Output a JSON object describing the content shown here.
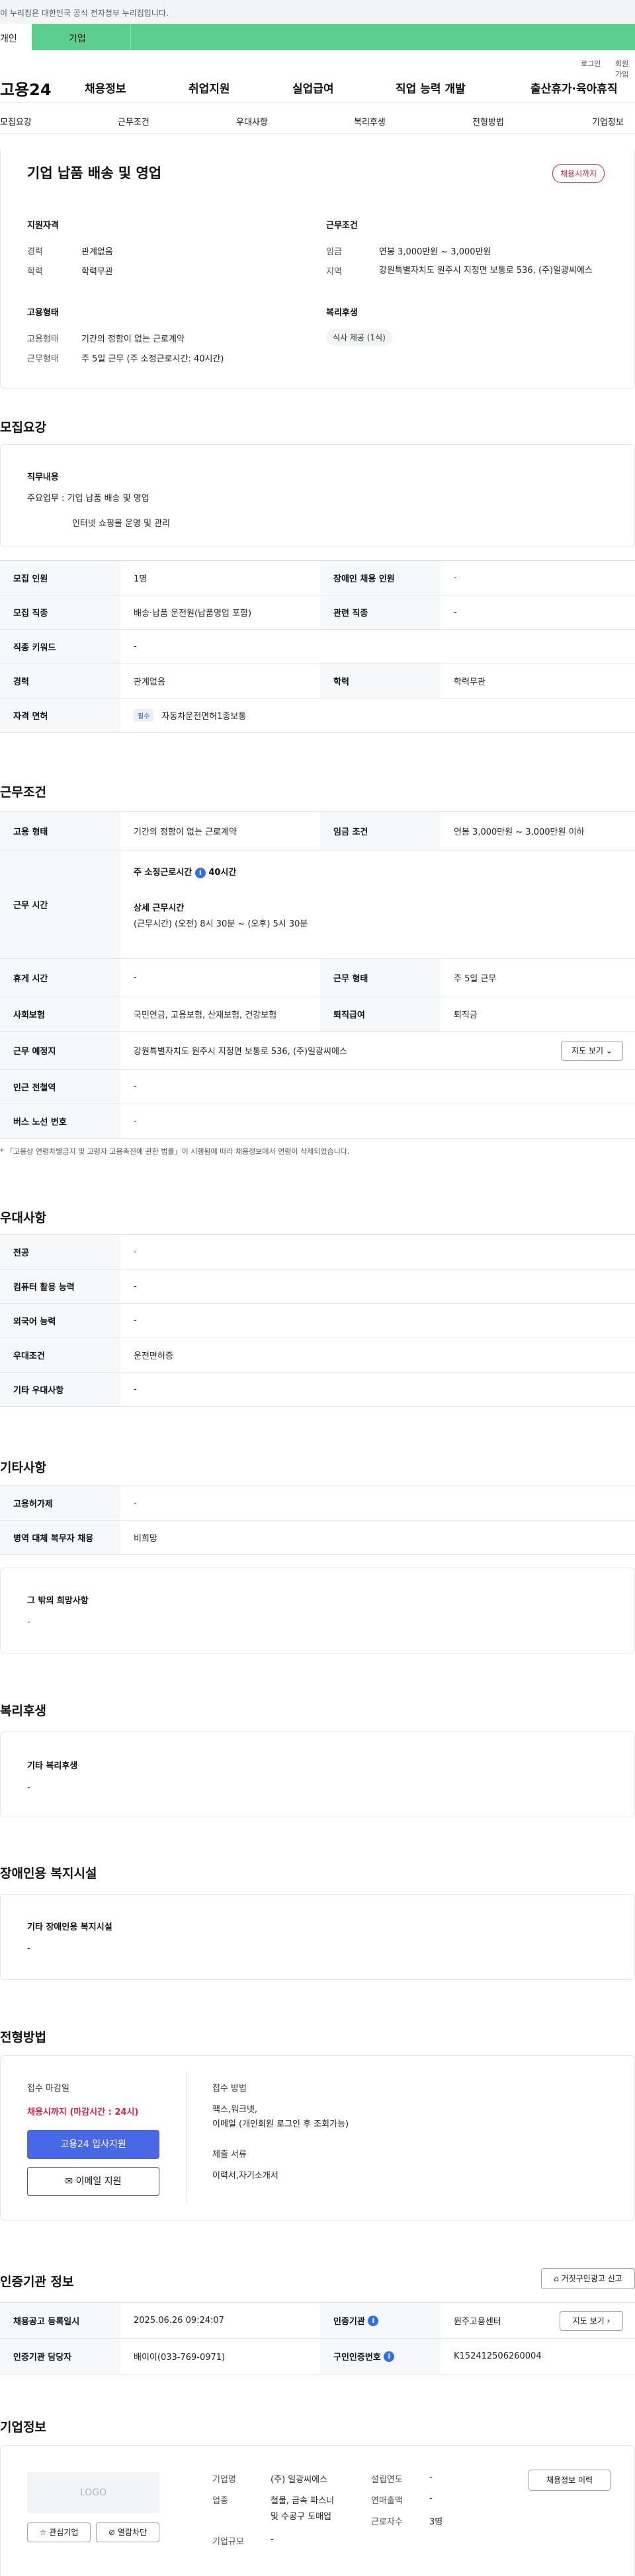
{
  "gov_banner": "이 누리집은 대한민국 공식 전자정부 누리집입니다.",
  "user_tabs": {
    "personal": "개인",
    "company": "기업"
  },
  "util": {
    "login": "로그인",
    "join": "회원가입"
  },
  "nav": {
    "logo": "고용24",
    "items": [
      "채용정보",
      "취업지원",
      "실업급여",
      "직업 능력 개발",
      "출산휴가·육아휴직"
    ]
  },
  "anchor": [
    "모집요강",
    "근무조건",
    "우대사항",
    "복리후생",
    "전형방법",
    "기업정보"
  ],
  "summary": {
    "title": "기업 납품 배송 및 영업",
    "badge": "채용시까지",
    "qual_title": "지원자격",
    "career_label": "경력",
    "career_value": "관계없음",
    "edu_label": "학력",
    "edu_value": "학력무관",
    "emp_title": "고용형태",
    "emp_label": "고용형태",
    "emp_value": "기간의 정함이 없는 근로계약",
    "work_label": "근무형태",
    "work_value": "주 5일 근무 (주 소정근로시간: 40시간)",
    "cond_title": "근무조건",
    "wage_label": "임금",
    "wage_value": "연봉 3,000만원 ~ 3,000만원",
    "area_label": "지역",
    "area_value": "강원특별자치도 원주시 지정면 보통로 536, (주)일광씨에스",
    "benefit_title": "복리후생",
    "benefit_chip": "식사 제공 (1식)"
  },
  "recruit": {
    "title": "모집요강",
    "duty_title": "직무내용",
    "duty_line1": "주요업무 : 기업 납품 배송 및 영업",
    "duty_line2": "인터넷 쇼핑몰 운영 및 관리",
    "rows": {
      "count_k": "모집 인원",
      "count_v": "1명",
      "disabled_k": "장애인 채용 인원",
      "disabled_v": "-",
      "job_k": "모집 직종",
      "job_v": "배송·납품 운전원(납품영업 포함)",
      "related_k": "관련 직종",
      "related_v": "-",
      "keyword_k": "직종 키워드",
      "keyword_v": "-",
      "career_k": "경력",
      "career_v": "관계없음",
      "edu_k": "학력",
      "edu_v": "학력무관",
      "license_k": "자격 면허",
      "license_tag": "필수",
      "license_v": "자동차운전면허1종보통"
    }
  },
  "work": {
    "title": "근무조건",
    "emp_k": "고용 형태",
    "emp_v": "기간의 정함이 없는 근로계약",
    "wage_k": "임금 조건",
    "wage_v": "연봉 3,000만원 ~ 3,000만원 이하",
    "time_k": "근무 시간",
    "time_weekly_label": "주 소정근로시간",
    "time_weekly_value": "40시간",
    "time_detail_label": "상세 근무시간",
    "time_detail_value": "(근무시간) (오전) 8시 30분 ~ (오후) 5시 30분",
    "rest_k": "휴게 시간",
    "rest_v": "-",
    "type_k": "근무 형태",
    "type_v": "주 5일 근무",
    "ins_k": "사회보험",
    "ins_v": "국민연금, 고용보험, 산재보험, 건강보험",
    "sev_k": "퇴직급여",
    "sev_v": "퇴직금",
    "place_k": "근무 예정지",
    "place_v": "강원특별자치도 원주시 지정면 보통로 536, (주)일광씨에스",
    "map_btn": "지도 보기",
    "subway_k": "인근 전철역",
    "subway_v": "-",
    "bus_k": "버스 노선 번호",
    "bus_v": "-",
    "note": "* 「고용상 연령차별금지 및 고령자 고용촉진에 관한 법률」이 시행됨에 따라 채용정보에서 연령이 삭제되었습니다."
  },
  "pref": {
    "title": "우대사항",
    "major_k": "전공",
    "major_v": "-",
    "pc_k": "컴퓨터 활용 능력",
    "pc_v": "-",
    "lang_k": "외국어 능력",
    "lang_v": "-",
    "cond_k": "우대조건",
    "cond_v": "운전면허증",
    "etc_k": "기타 우대사항",
    "etc_v": "-"
  },
  "etc": {
    "title": "기타사항",
    "permit_k": "고용허가제",
    "permit_v": "-",
    "military_k": "병역 대체 복무자 채용",
    "military_v": "비희망",
    "hope_title": "그 밖의 희망사항",
    "hope_v": "-"
  },
  "welfare": {
    "title": "복리후생",
    "box_title": "기타 복리후생",
    "box_v": "-"
  },
  "facility": {
    "title": "장애인용 복지시설",
    "box_title": "기타 장애인용 복지시설",
    "box_v": "-"
  },
  "selection": {
    "title": "전형방법",
    "deadline_label": "접수 마감일",
    "deadline_value": "채용시까지 (마감시간 : 24시)",
    "apply_btn": "고용24 입사지원",
    "email_btn": "이메일 지원",
    "method_label": "접수 방법",
    "method_value1": "팩스,워크넷,",
    "method_value2": "이메일 (개인회원 로그인 후 조회가능)",
    "docs_label": "제출 서류",
    "docs_value": "이력서,자기소개서"
  },
  "cert": {
    "title": "인증기관 정보",
    "report_btn": "거짓구인광고 신고",
    "reg_k": "채용공고 등록일시",
    "reg_v": "2025.06.26 09:24:07",
    "agency_k": "인증기관",
    "agency_v": "원주고용센터",
    "map_btn": "지도 보기",
    "manager_k": "인증기관 담당자",
    "manager_v": "배이이(033-769-0971)",
    "num_k": "구인인증번호",
    "num_v": "K152412506260004"
  },
  "company": {
    "title": "기업정보",
    "logo": "LOGO",
    "fav_btn": "관심기업",
    "block_btn": "열람차단",
    "name_k": "기업명",
    "name_v": "(주) 일광씨에스",
    "industry_k": "업종",
    "industry_v1": "철물, 금속 파스너",
    "industry_v2": "및 수공구 도매업",
    "size_k": "기업규모",
    "size_v": "-",
    "founded_k": "설립연도",
    "founded_v": "-",
    "sales_k": "연매출액",
    "sales_v": "-",
    "employees_k": "근로자수",
    "employees_v": "3명",
    "history_btn": "채용정보 이력"
  },
  "colors": {
    "accent": "#5ccf8c",
    "primary": "#4868e8",
    "badge": "#e11d48"
  }
}
